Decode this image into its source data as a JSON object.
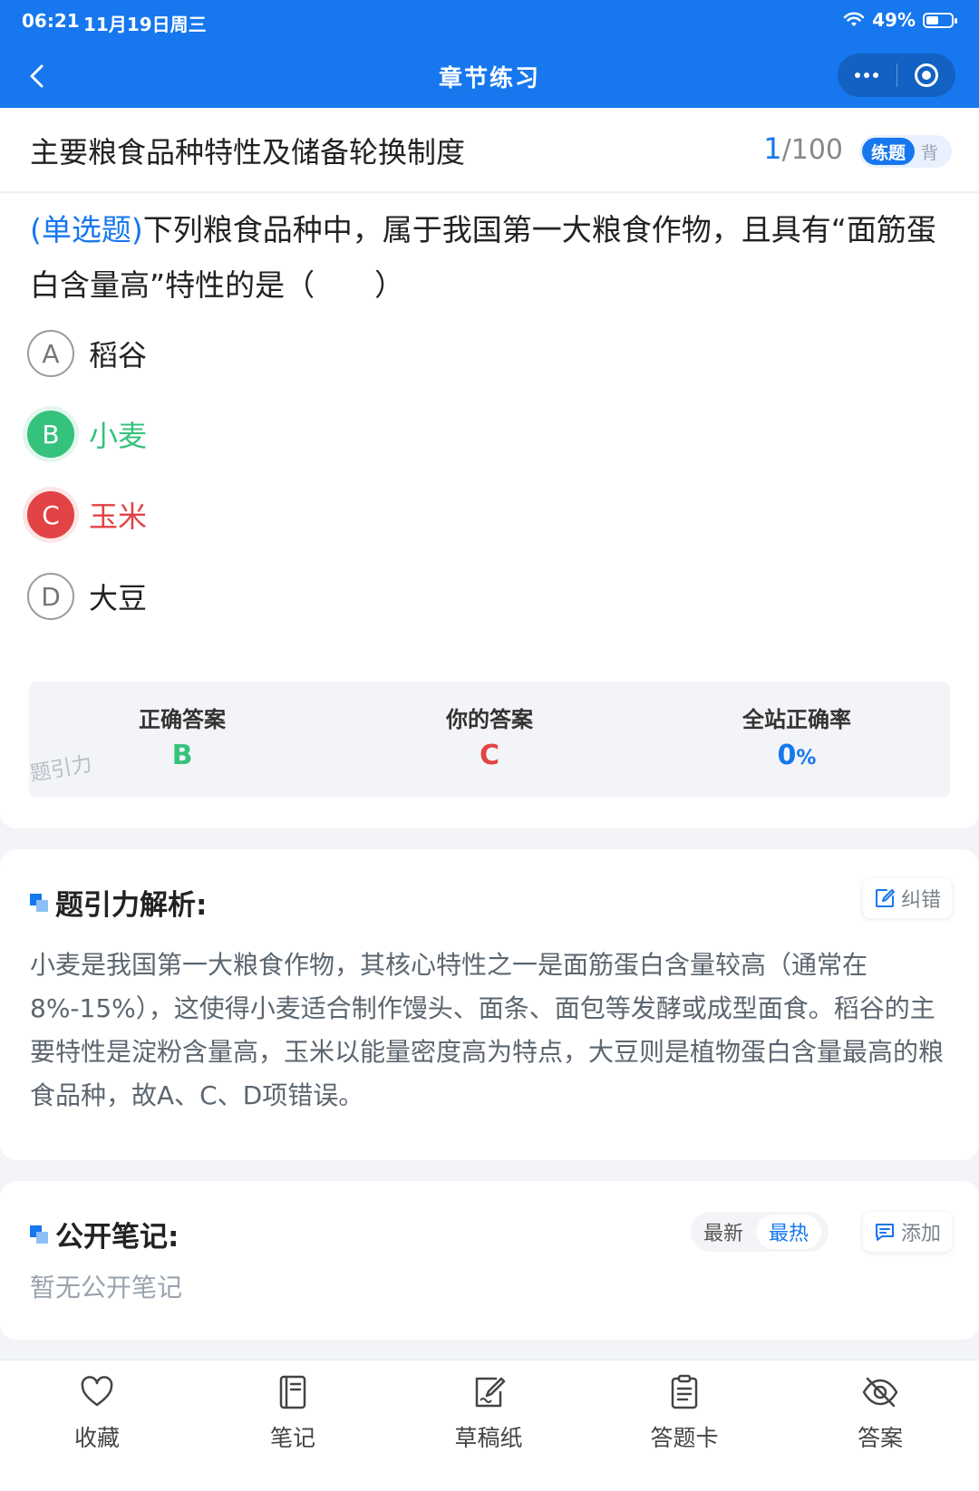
{
  "status_bar": {
    "time": "06:21",
    "date": "11月19日周三",
    "battery_text": "49%",
    "battery_level": 0.49
  },
  "nav": {
    "title": "章节练习"
  },
  "chapter": {
    "title": "主要粮食品种特性及储备轮换制度",
    "current": "1",
    "total": "/100",
    "mode_active": "练题",
    "mode_inactive": "背"
  },
  "question": {
    "type_label": "(单选题)",
    "text": "下列粮食品种中，属于我国第一大粮食作物，且具有“面筋蛋白含量高”特性的是（　　）",
    "options": [
      {
        "letter": "A",
        "text": "稻谷",
        "state": "normal"
      },
      {
        "letter": "B",
        "text": "小麦",
        "state": "correct"
      },
      {
        "letter": "C",
        "text": "玉米",
        "state": "wrong"
      },
      {
        "letter": "D",
        "text": "大豆",
        "state": "normal"
      }
    ]
  },
  "result": {
    "correct_label": "正确答案",
    "correct_value": "B",
    "yours_label": "你的答案",
    "yours_value": "C",
    "rate_label": "全站正确率",
    "rate_value": "0",
    "rate_unit": "%",
    "watermark": "题引力"
  },
  "analysis": {
    "title": "题引力解析:",
    "report_label": "纠错",
    "text": "小麦是我国第一大粮食作物，其核心特性之一是面筋蛋白含量较高（通常在8%-15%），这使得小麦适合制作馒头、面条、面包等发酵或成型面食。稻谷的主要特性是淀粉含量高，玉米以能量密度高为特点，大豆则是植物蛋白含量最高的粮食品种，故A、C、D项错误。"
  },
  "notes": {
    "title": "公开笔记:",
    "sort_newest": "最新",
    "sort_hottest": "最热",
    "add_label": "添加",
    "empty_text": "暂无公开笔记"
  },
  "toolbar": {
    "items": [
      {
        "label": "收藏",
        "icon": "heart-icon"
      },
      {
        "label": "笔记",
        "icon": "notebook-icon"
      },
      {
        "label": "草稿纸",
        "icon": "draft-pen-icon"
      },
      {
        "label": "答题卡",
        "icon": "clipboard-icon"
      },
      {
        "label": "答案",
        "icon": "eye-off-icon"
      }
    ]
  },
  "colors": {
    "brand_blue": "#1677ee",
    "correct_green": "#35c27c",
    "wrong_red": "#e24345"
  }
}
